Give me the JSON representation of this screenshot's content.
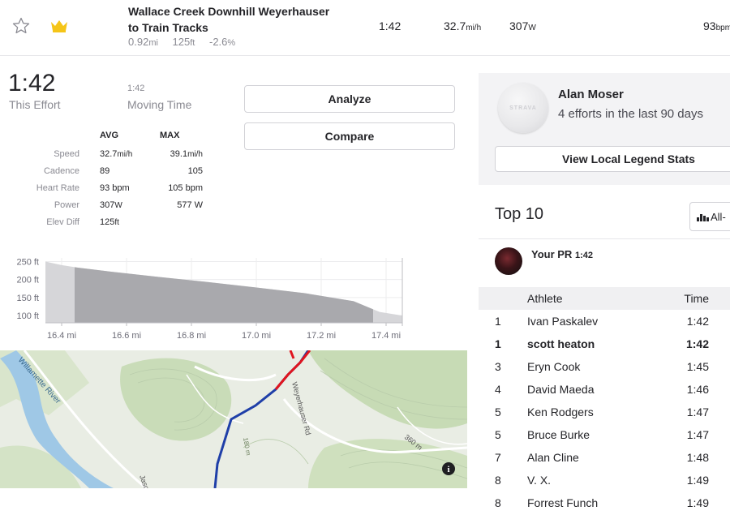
{
  "segment": {
    "name_line1": "Wallace Creek Downhill Weyerhauser",
    "name_line2": "to Train Tracks",
    "distance": "0.92",
    "distance_unit": "mi",
    "elev": "125",
    "elev_unit": "ft",
    "grade": "-2.6",
    "grade_unit": "%",
    "time": "1:42",
    "speed": "32.7",
    "speed_unit": "mi/h",
    "power": "307",
    "power_unit": "W",
    "hr": "93",
    "hr_unit": "bpm"
  },
  "effort": {
    "time": "1:42",
    "time_label": "This Effort",
    "moving_time": "1:42",
    "moving_label": "Moving Time",
    "analyze_label": "Analyze",
    "compare_label": "Compare"
  },
  "stats": {
    "avg_header": "AVG",
    "max_header": "MAX",
    "rows": [
      {
        "label": "Speed",
        "avg": "32.7",
        "avg_unit": "mi/h",
        "max": "39.1",
        "max_unit": "mi/h"
      },
      {
        "label": "Cadence",
        "avg": "89",
        "avg_unit": "",
        "max": "105",
        "max_unit": ""
      },
      {
        "label": "Heart Rate",
        "avg": "93 bpm",
        "avg_unit": "",
        "max": "105 bpm",
        "max_unit": ""
      },
      {
        "label": "Power",
        "avg": "307",
        "avg_unit": "W",
        "max": "577 W",
        "max_unit": ""
      },
      {
        "label": "Elev Diff",
        "avg": "125",
        "avg_unit": "ft",
        "max": "",
        "max_unit": ""
      }
    ]
  },
  "chart_data": {
    "type": "area",
    "x_ticks": [
      "16.4 mi",
      "16.6 mi",
      "16.8 mi",
      "17.0 mi",
      "17.2 mi",
      "17.4 mi"
    ],
    "y_ticks": [
      "250 ft",
      "200 ft",
      "150 ft",
      "100 ft"
    ],
    "x": [
      16.35,
      16.4,
      16.45,
      16.55,
      16.7,
      16.85,
      17.0,
      17.15,
      17.3,
      17.38,
      17.45
    ],
    "y": [
      250,
      240,
      233,
      222,
      207,
      193,
      178,
      162,
      140,
      110,
      100
    ],
    "xlim": [
      16.35,
      17.45
    ],
    "ylim": [
      80,
      260
    ],
    "highlight_range": [
      16.44,
      17.36
    ],
    "colors": {
      "highlight": "#a9a9ad",
      "context": "#d6d6d9"
    }
  },
  "map": {
    "river_label": "Willamette River",
    "road_label": "Weyerhauser Rd",
    "contour_label_1": "180 m",
    "contour_label_2": "360 m",
    "road_label_2": "Jaso",
    "info_icon": "i"
  },
  "legend": {
    "name": "Alan Moser",
    "subtitle": "4 efforts in the last 90 days",
    "button_label": "View Local Legend Stats",
    "avatar_text": "STRAVA"
  },
  "leaderboard": {
    "title": "Top 10",
    "filter_label": "All-",
    "pr_label": "Your PR",
    "pr_time": "1:42",
    "col_athlete": "Athlete",
    "col_time": "Time",
    "rows": [
      {
        "rank": "1",
        "name": "Ivan Paskalev",
        "time": "1:42"
      },
      {
        "rank": "1",
        "name": "scott heaton",
        "time": "1:42"
      },
      {
        "rank": "3",
        "name": "Eryn Cook",
        "time": "1:45"
      },
      {
        "rank": "4",
        "name": "David Maeda",
        "time": "1:46"
      },
      {
        "rank": "5",
        "name": "Ken Rodgers",
        "time": "1:47"
      },
      {
        "rank": "5",
        "name": "Bruce Burke",
        "time": "1:47"
      },
      {
        "rank": "7",
        "name": "Alan Cline",
        "time": "1:48"
      },
      {
        "rank": "8",
        "name": "V. X.",
        "time": "1:49"
      },
      {
        "rank": "8",
        "name": "Forrest Funch",
        "time": "1:49"
      }
    ],
    "highlight_rank_index": 1
  },
  "colors": {
    "brand_gold": "#f5c518",
    "route_blue": "#1f3fa8",
    "route_red": "#e0141e"
  }
}
